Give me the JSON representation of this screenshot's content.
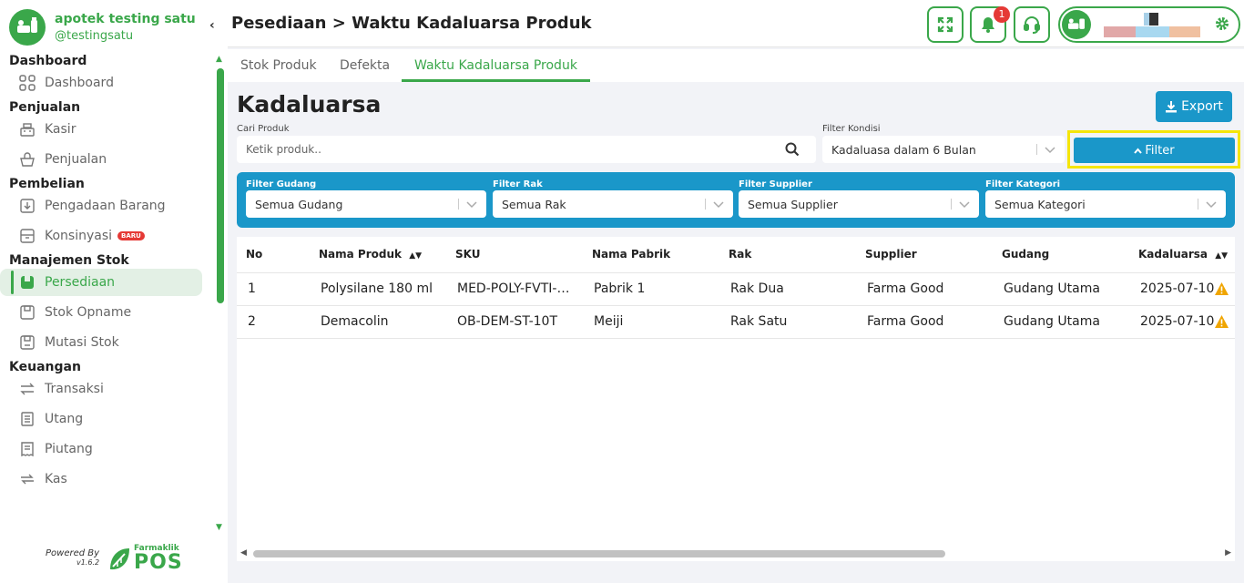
{
  "brand": {
    "name": "apotek testing satu",
    "handle": "@testingsatu"
  },
  "sidebar": {
    "sections": [
      {
        "title": "Dashboard",
        "items": [
          {
            "label": "Dashboard",
            "icon": "grid-icon"
          }
        ]
      },
      {
        "title": "Penjualan",
        "items": [
          {
            "label": "Kasir",
            "icon": "cash-register-icon"
          },
          {
            "label": "Penjualan",
            "icon": "basket-icon"
          }
        ]
      },
      {
        "title": "Pembelian",
        "items": [
          {
            "label": "Pengadaan Barang",
            "icon": "box-arrow-icon"
          },
          {
            "label": "Konsinyasi",
            "icon": "archive-icon",
            "badge": "BARU"
          }
        ]
      },
      {
        "title": "Manajemen Stok",
        "items": [
          {
            "label": "Persediaan",
            "icon": "inventory-icon",
            "active": true
          },
          {
            "label": "Stok Opname",
            "icon": "clipboard-icon"
          },
          {
            "label": "Mutasi Stok",
            "icon": "transfer-box-icon"
          }
        ]
      },
      {
        "title": "Keuangan",
        "items": [
          {
            "label": "Transaksi",
            "icon": "exchange-icon"
          },
          {
            "label": "Utang",
            "icon": "ledger-icon"
          },
          {
            "label": "Piutang",
            "icon": "receipt-icon"
          },
          {
            "label": "Kas",
            "icon": "cash-flow-icon"
          }
        ]
      }
    ],
    "powered_by": "Powered By",
    "version": "v1.6.2",
    "product_small": "Farmaklik",
    "product_big": "POS"
  },
  "header": {
    "title": "Pesediaan > Waktu Kadaluarsa Produk",
    "notification_count": "1"
  },
  "tabs": [
    {
      "label": "Stok Produk"
    },
    {
      "label": "Defekta"
    },
    {
      "label": "Waktu Kadaluarsa Produk",
      "active": true
    }
  ],
  "main": {
    "title": "Kadaluarsa",
    "export_label": "Export",
    "search": {
      "label": "Cari Produk",
      "placeholder": "Ketik produk.."
    },
    "condition": {
      "label": "Filter Kondisi",
      "value": "Kadaluasa dalam 6 Bulan"
    },
    "filter_button": "Filter",
    "filters": [
      {
        "label": "Filter Gudang",
        "value": "Semua Gudang"
      },
      {
        "label": "Filter Rak",
        "value": "Semua Rak"
      },
      {
        "label": "Filter Supplier",
        "value": "Semua Supplier"
      },
      {
        "label": "Filter Kategori",
        "value": "Semua Kategori"
      }
    ]
  },
  "table": {
    "columns": [
      "No",
      "Nama Produk",
      "SKU",
      "Nama Pabrik",
      "Rak",
      "Supplier",
      "Gudang",
      "Kadaluarsa"
    ],
    "rows": [
      [
        "1",
        "Polysilane 180 ml",
        "MED-POLY-FVTI-…",
        "Pabrik 1",
        "Rak Dua",
        "Farma Good",
        "Gudang Utama",
        "2025-07-10"
      ],
      [
        "2",
        "Demacolin",
        "OB-DEM-ST-10T",
        "Meiji",
        "Rak Satu",
        "Farma Good",
        "Gudang Utama",
        "2025-07-10"
      ]
    ]
  },
  "colors": {
    "brand_green": "#3aa74a",
    "primary_blue": "#1a97c9",
    "warning": "#f0a500",
    "badge_red": "#e53935",
    "highlight": "#f5e50a"
  }
}
